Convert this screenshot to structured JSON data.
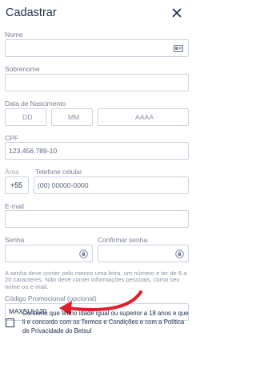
{
  "header": {
    "title": "Cadastrar"
  },
  "fields": {
    "nome": {
      "label": "Nome"
    },
    "sobrenome": {
      "label": "Sobrenome"
    },
    "nascimento": {
      "label": "Data de Nascimento",
      "day": "DD",
      "month": "MM",
      "year": "AAAA"
    },
    "cpf": {
      "label": "CPF",
      "placeholder": "123.456.789-10"
    },
    "area": {
      "label": "Área",
      "value": "+55"
    },
    "telefone": {
      "label": "Telefone celular",
      "placeholder": "(00) 00000-0000"
    },
    "email": {
      "label": "E-mail"
    },
    "senha": {
      "label": "Senha"
    },
    "confirmar": {
      "label": "Confirmar senha"
    },
    "password_hint": "A senha deve conter pelo menos uma letra, um número e ter de 6 a 20 caracteres. Não deve conter informações pessoais, como seu nome ou e-mail.",
    "promo": {
      "label": "Código Promocional (opcional)",
      "value": "MAXSUL120"
    }
  },
  "consent": {
    "text_before": "Confirmo que tenho idade igual ou superior a 18 anos e que li e concordo com os ",
    "terms_link": "Termos e Condições",
    "text_middle": " e com a ",
    "privacy_link": "Política de Privacidade do Betsul"
  },
  "colors": {
    "text": "#1d2b4a",
    "border": "#cdd3de",
    "arrow": "#e11d2a"
  }
}
